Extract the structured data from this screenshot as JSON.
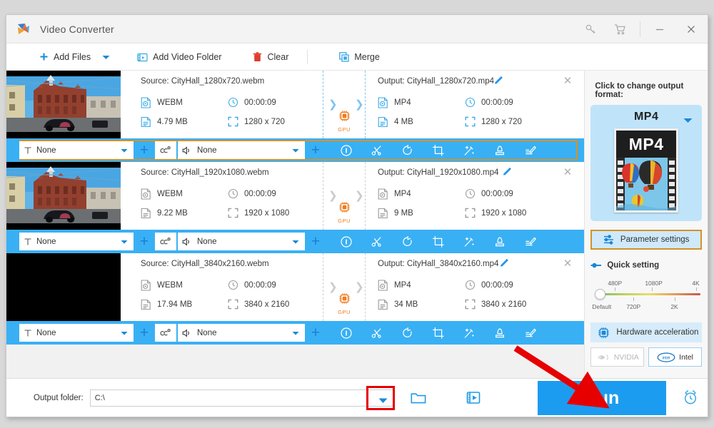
{
  "window": {
    "title": "Video Converter",
    "controls": [
      {
        "name": "key-icon",
        "glyph": "key"
      },
      {
        "name": "cart-icon",
        "glyph": "cart"
      },
      {
        "name": "minimize",
        "glyph": "minimize"
      },
      {
        "name": "close",
        "glyph": "close"
      }
    ]
  },
  "menubar": {
    "add_files": "Add Files",
    "add_video_folder": "Add Video Folder",
    "clear": "Clear",
    "merge": "Merge"
  },
  "files": [
    {
      "selected": true,
      "thumb": "city-street",
      "source_label": "Source: CityHall_1280x720.webm",
      "source_format": "WEBM",
      "source_duration": "00:00:09",
      "source_size": "4.79 MB",
      "source_resolution": "1280 x 720",
      "gpu_label": "GPU",
      "output_label": "Output: CityHall_1280x720.mp4",
      "output_format": "MP4",
      "output_duration": "00:00:09",
      "output_size": "4 MB",
      "output_resolution": "1280 x 720",
      "subtitle": "None",
      "audio": "None",
      "highlighted": true
    },
    {
      "selected": false,
      "thumb": "city-street",
      "source_label": "Source: CityHall_1920x1080.webm",
      "source_format": "WEBM",
      "source_duration": "00:00:09",
      "source_size": "9.22 MB",
      "source_resolution": "1920 x 1080",
      "gpu_label": "GPU",
      "output_label": "Output: CityHall_1920x1080.mp4",
      "output_format": "MP4",
      "output_duration": "00:00:09",
      "output_size": "9 MB",
      "output_resolution": "1920 x 1080",
      "subtitle": "None",
      "audio": "None",
      "highlighted": false
    },
    {
      "selected": false,
      "thumb": "black",
      "source_label": "Source: CityHall_3840x2160.webm",
      "source_format": "WEBM",
      "source_duration": "00:00:09",
      "source_size": "17.94 MB",
      "source_resolution": "3840 x 2160",
      "gpu_label": "GPU",
      "output_label": "Output: CityHall_3840x2160.mp4",
      "output_format": "MP4",
      "output_duration": "00:00:09",
      "output_size": "34 MB",
      "output_resolution": "3840 x 2160",
      "subtitle": "None",
      "audio": "None",
      "highlighted": false
    }
  ],
  "row_tools": [
    {
      "name": "info-icon",
      "label": "Information"
    },
    {
      "name": "scissors-icon",
      "label": "Trim"
    },
    {
      "name": "rotate-icon",
      "label": "Rotate"
    },
    {
      "name": "crop-icon",
      "label": "Crop"
    },
    {
      "name": "magic-wand-icon",
      "label": "Effects"
    },
    {
      "name": "watermark-icon",
      "label": "Watermark"
    },
    {
      "name": "subtitle-edit-icon",
      "label": "Subtitle"
    }
  ],
  "sidebar": {
    "change_format_title": "Click to change output format:",
    "format_name": "MP4",
    "poster_text": "MP4",
    "parameter_settings": "Parameter settings",
    "quick_setting": "Quick setting",
    "slider": {
      "top_labels": [
        "480P",
        "1080P",
        "4K"
      ],
      "bottom_labels": [
        "Default",
        "720P",
        "2K"
      ],
      "value": "Default"
    },
    "hardware_acceleration": "Hardware acceleration",
    "gpu_buttons": [
      {
        "label": "NVIDIA",
        "enabled": false
      },
      {
        "label": "Intel",
        "enabled": true
      }
    ]
  },
  "bottom": {
    "output_folder_label": "Output folder:",
    "output_folder_value": "C:\\",
    "output_folder_placeholder": "C:\\",
    "run_label": "Run"
  },
  "colors": {
    "accent_blue": "#39b0f4",
    "run_blue": "#1c9cf0",
    "highlight_orange": "#d5912a",
    "annotation_red": "#e60000",
    "gpu_orange": "#f07c1e"
  }
}
